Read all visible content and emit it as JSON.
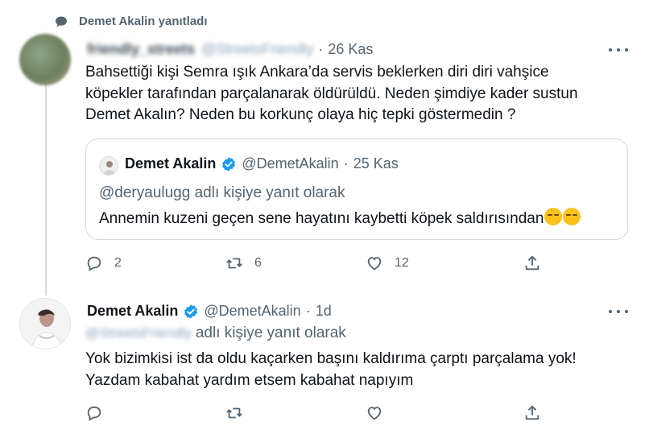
{
  "context": {
    "label": "Demet Akalin yanıtladı",
    "icon": "speech-bubble-icon"
  },
  "tweet1": {
    "display_name": "friendly_streets",
    "handle": "@StreetsFriendly",
    "separator": "·",
    "time": "26 Kas",
    "lines": [
      "Bahsettiği kişi Semra ışık Ankara’da servis beklerken diri diri vahşice",
      "köpekler tarafından parçalanarak öldürüldü. Neden şimdiye kader sustun",
      "Demet Akalın? Neden bu korkunç olaya hiç tepki göstermedin ?"
    ],
    "quote": {
      "display_name": "Demet Akalin",
      "handle": "@DemetAkalin",
      "separator": "·",
      "time": "25 Kas",
      "reply_to": "@deryaulugg adlı kişiye yanıt olarak",
      "text": "Annemin kuzeni geçen sene hayatını kaybetti köpek saldırısından"
    },
    "stats": {
      "replies": "2",
      "retweets": "6",
      "likes": "12"
    }
  },
  "tweet2": {
    "display_name": "Demet Akalin",
    "handle": "@DemetAkalin",
    "separator": "·",
    "time": "1d",
    "reply_to_handle": "@StreetsFriendly",
    "reply_to_suffix": "adlı kişiye yanıt olarak",
    "lines": [
      "Yok bizimkisi ist da oldu kaçarken başını kaldırıma çarptı parçalama yok!",
      "Yazdam kabahat yardım etsem kabahat napıyım"
    ]
  },
  "colors": {
    "text": "#0f1419",
    "muted": "#536471",
    "verified": "#1d9bf0",
    "border": "#cfd9de"
  }
}
